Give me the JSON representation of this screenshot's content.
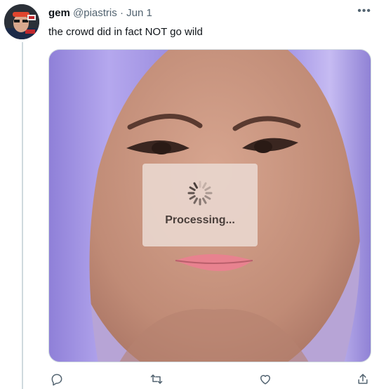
{
  "tweet": {
    "author_name": "gem",
    "handle": "@piastris",
    "separator": "·",
    "date": "Jun 1",
    "more_label": "•••",
    "text": "the crowd did in fact NOT go wild"
  },
  "media": {
    "overlay_text": "Processing...",
    "colors": {
      "hair": "#a99be8",
      "skin": "#c59483",
      "lips": "#e8828f",
      "overlay": "#e8d5cc"
    }
  },
  "actions": {
    "reply": "reply-icon",
    "retweet": "retweet-icon",
    "like": "heart-icon",
    "share": "share-icon"
  },
  "colors": {
    "secondary_text": "#536471",
    "icon": "#536471",
    "border": "#cfd9de"
  }
}
